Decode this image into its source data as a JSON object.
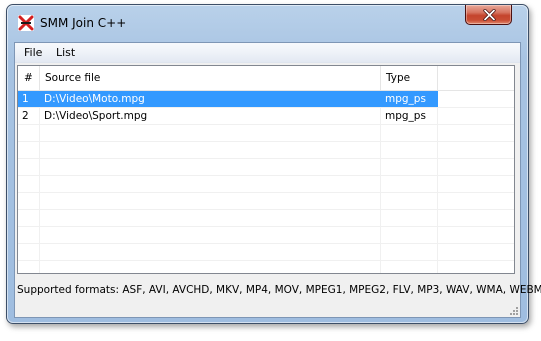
{
  "window": {
    "title": "SMM Join C++",
    "app_icon": "smm-logo-icon",
    "close_icon": "close-icon"
  },
  "menu": {
    "items": [
      {
        "label": "File"
      },
      {
        "label": "List"
      }
    ]
  },
  "file_list": {
    "columns": [
      {
        "label": "#"
      },
      {
        "label": "Source file"
      },
      {
        "label": "Type"
      }
    ],
    "rows": [
      {
        "index": "1",
        "source": "D:\\Video\\Moto.mpg",
        "type": "mpg_ps",
        "selected": true
      },
      {
        "index": "2",
        "source": "D:\\Video\\Sport.mpg",
        "type": "mpg_ps",
        "selected": false
      }
    ]
  },
  "status": {
    "supported_formats": "Supported formats: ASF, AVI, AVCHD, MKV, MP4, MOV, MPEG1, MPEG2, FLV, MP3, WAV, WMA, WEBM"
  },
  "colors": {
    "selection": "#3399ff",
    "close_button": "#c4442d",
    "frame": "#a7c3e2"
  }
}
